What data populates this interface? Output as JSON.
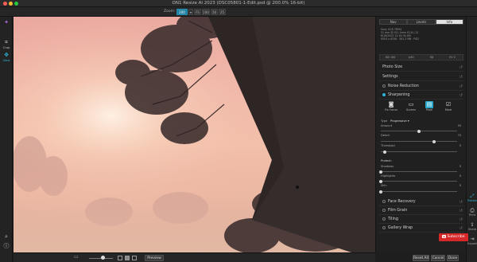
{
  "window": {
    "title": "ON1 Resize AI 2023 (DSC05801-1-Edit.psd @ 200.0% 16-bit)"
  },
  "toolbar": {
    "zoom_label": "Zoom:",
    "zoom_value": "200",
    "zoom_options": [
      "FS",
      "100",
      "50",
      "25"
    ]
  },
  "left_tools": [
    {
      "label": "Crop",
      "icon": "crop-icon"
    },
    {
      "label": "View",
      "icon": "view-icon"
    }
  ],
  "panel": {
    "tabs": [
      "Nav",
      "Levels",
      "Info"
    ],
    "active_tab": "Info",
    "meta_lines": [
      "Sony ILCE-7RM4",
      "51 mm @ f/11.0mm f/2.8 (-3)",
      "8/19/2022 12:34:34 AM",
      "9504 x 6336 · 361.3 MB · PSD"
    ],
    "histo_stats": [
      "ISO 100",
      "1/40",
      "f/8",
      "EV 0"
    ],
    "sections": {
      "photo_size": "Photo Size",
      "settings": "Settings",
      "noise_reduction": "Noise Reduction",
      "sharpening": "Sharpening",
      "face_recovery": "Face Recovery",
      "film_grain": "Film Grain",
      "tiling": "Tiling",
      "gallery_wrap": "Gallery Wrap"
    },
    "presets": [
      {
        "label": "Fix Focus",
        "icon": "camera-icon"
      },
      {
        "label": "Screen",
        "icon": "monitor-icon"
      },
      {
        "label": "Pearl",
        "icon": "printer-icon"
      },
      {
        "label": "More",
        "icon": "more-icon"
      }
    ],
    "active_preset": "Pearl",
    "type_label": "Type",
    "type_value": "Progressive",
    "sharpen_sliders": [
      {
        "label": "Amount",
        "value": "50",
        "level": 0.5
      },
      {
        "label": "Detail",
        "value": "70",
        "level": 0.7
      },
      {
        "label": "Threshold",
        "value": "5",
        "level": 0.05
      }
    ],
    "protect_label": "Protect:",
    "protect_sliders": [
      {
        "label": "Shadows",
        "value": "0",
        "level": 0.0
      },
      {
        "label": "Highlights",
        "value": "0",
        "level": 0.0
      },
      {
        "label": "Skin",
        "value": "0",
        "level": 0.0
      }
    ]
  },
  "right_tools": [
    {
      "label": "Resize",
      "icon": "resize-icon"
    },
    {
      "label": "Print",
      "icon": "print-icon"
    },
    {
      "label": "Share",
      "icon": "share-icon"
    },
    {
      "label": "Export",
      "icon": "export-icon"
    }
  ],
  "bottom": {
    "preview_label": "Preview",
    "reset_all": "Reset All",
    "cancel": "Cancel",
    "done": "Done"
  },
  "overlay": {
    "subscribe_label": "Subscribe"
  },
  "colors": {
    "accent": "#2bb6d8",
    "subscribe": "#d62828"
  }
}
